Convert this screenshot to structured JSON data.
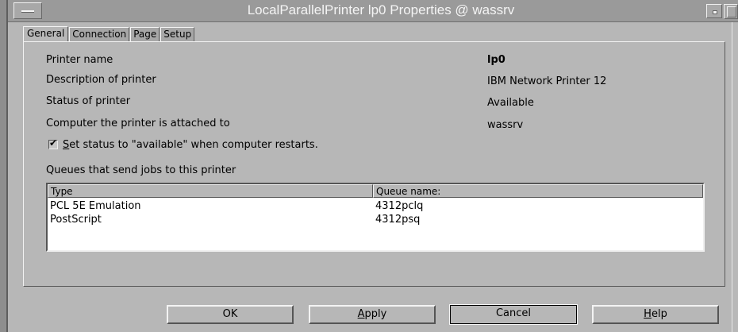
{
  "window": {
    "title": "LocalParallelPrinter lp0 Properties @ wassrv"
  },
  "tabs": [
    {
      "label": "General",
      "active": true
    },
    {
      "label": "Connection",
      "active": false
    },
    {
      "label": "Page",
      "active": false
    },
    {
      "label": "Setup",
      "active": false
    }
  ],
  "general": {
    "fields": [
      {
        "label": "Printer name",
        "value": "lp0"
      },
      {
        "label": "Description of printer",
        "value": "IBM Network Printer 12"
      },
      {
        "label": "Status of printer",
        "value": "Available"
      },
      {
        "label": "Computer the printer is attached to",
        "value": "wassrv"
      }
    ],
    "restart_checkbox": {
      "checked": true,
      "mnemonic": "S",
      "label_rest": "et status to \"available\" when computer restarts."
    },
    "queues_title": "Queues that send jobs to this printer",
    "queues_table": {
      "columns": [
        "Type",
        "Queue name:"
      ],
      "rows": [
        [
          "PCL 5E Emulation",
          "4312pclq"
        ],
        [
          "PostScript",
          "4312psq"
        ]
      ]
    }
  },
  "buttons": {
    "ok": "OK",
    "apply_mnemonic": "A",
    "apply_rest": "pply",
    "cancel": "Cancel",
    "help_mnemonic": "H",
    "help_rest": "elp"
  }
}
